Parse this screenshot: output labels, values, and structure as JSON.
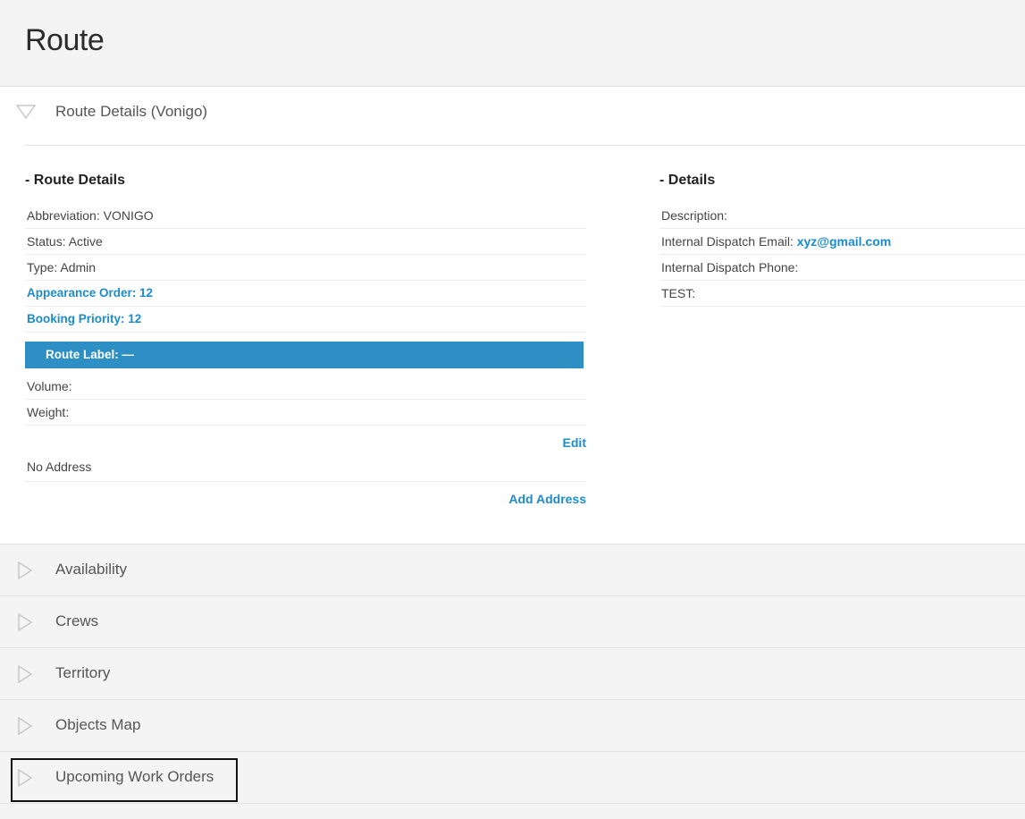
{
  "page": {
    "title": "Route"
  },
  "details_panel": {
    "header_label": "Route Details (Vonigo)",
    "route_details": {
      "section_title": "- Route Details",
      "abbreviation": "Abbreviation: VONIGO",
      "status": "Status: Active",
      "type": "Type: Admin",
      "appearance_order": "Appearance Order: 12",
      "booking_priority": "Booking Priority: 12",
      "route_label": "Route Label: —",
      "volume": "Volume:",
      "weight": "Weight:",
      "edit_link": "Edit",
      "no_address": "No Address",
      "add_address_link": "Add Address"
    },
    "details": {
      "section_title": "- Details",
      "description": "Description:",
      "dispatch_email_label": "Internal Dispatch Email: ",
      "dispatch_email_value": "xyz@gmail.com",
      "dispatch_phone": "Internal Dispatch Phone:",
      "test": "TEST:"
    }
  },
  "collapsed_panels": [
    {
      "label": "Availability"
    },
    {
      "label": "Crews"
    },
    {
      "label": "Territory"
    },
    {
      "label": "Objects Map"
    },
    {
      "label": "Upcoming Work Orders"
    }
  ],
  "colors": {
    "accent": "#1c8ccc",
    "label_bar": "#2e8fc4",
    "background": "#f4f4f4"
  }
}
